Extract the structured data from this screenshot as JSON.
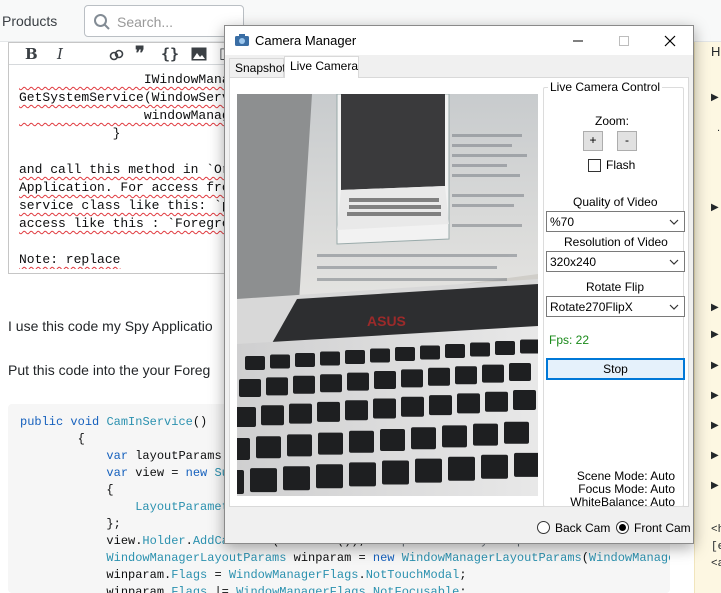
{
  "page": {
    "products_label": "Products",
    "search_placeholder": "Search...",
    "editor_lines": [
      {
        "text": "                IWindowMana",
        "squiggle": true
      },
      {
        "text": "GetSystemService(WindowServ",
        "squiggle": true
      },
      {
        "text": "                windowManag",
        "squiggle": true
      },
      {
        "text": "            }",
        "squiggle": false
      },
      {
        "text": "",
        "squiggle": false
      },
      {
        "text": "and call this method in `Or",
        "squiggle": true
      },
      {
        "text": "Application. For access fro",
        "squiggle": true
      },
      {
        "text": "service class like this: `p",
        "squiggle": true
      },
      {
        "text": "access like this : `Foregro",
        "squiggle": true
      },
      {
        "text": "",
        "squiggle": false
      },
      {
        "text": "Note: replace",
        "squiggle": true
      }
    ],
    "para1": "I use this code my Spy Applicatio",
    "para2": "Put this code into the your Foreg",
    "right_header": "H",
    "right_codes": [
      "<h",
      "[e",
      "<a"
    ]
  },
  "window": {
    "title": "Camera Manager",
    "tabs": [
      "Snapshot",
      "Live Camera"
    ],
    "active_tab": "Live Camera",
    "group_title": "Live Camera Control",
    "zoom_label": "Zoom:",
    "zoom_in": "+",
    "zoom_out": "-",
    "flash_label": "Flash",
    "flash_checked": false,
    "quality_label": "Quality of Video",
    "quality_value": "%70",
    "resolution_label": "Resolution of Video",
    "resolution_value": "320x240",
    "rotate_label": "Rotate Flip",
    "rotate_value": "Rotate270FlipX",
    "fps_text": "Fps: 22",
    "stop_label": "Stop",
    "scene_mode": "Scene Mode: Auto",
    "focus_mode": "Focus Mode: Auto",
    "white_balance": "WhiteBalance: Auto",
    "back_cam_label": "Back Cam",
    "front_cam_label": "Front Cam",
    "selected_cam": "Front Cam"
  },
  "colors": {
    "fps_green": "#1a8a1a",
    "focus_blue": "#0078d7",
    "code_keyword": "#1560bd",
    "code_type": "#2b91af"
  }
}
